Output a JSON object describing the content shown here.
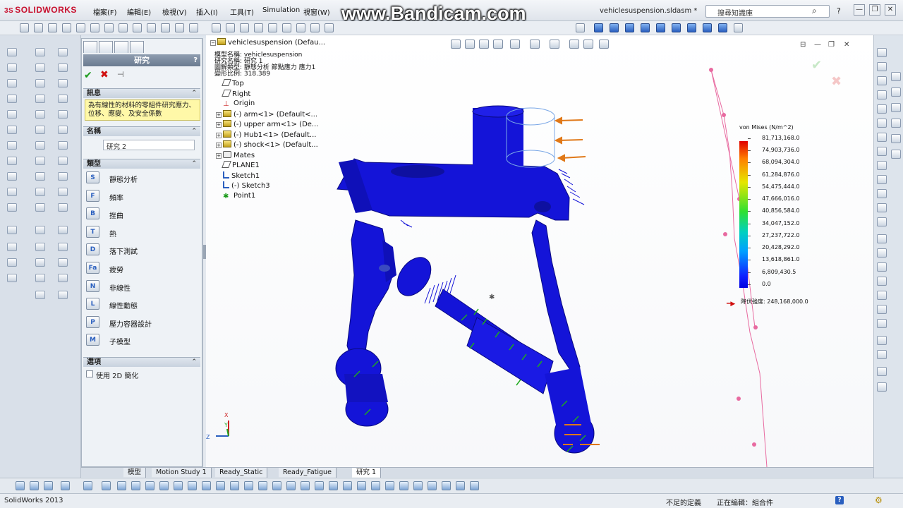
{
  "titlebar": {
    "logo_prefix": "3S",
    "logo": "SOLIDWORKS",
    "menus": [
      "檔案(F)",
      "編輯(E)",
      "檢視(V)",
      "插入(I)",
      "工具(T)",
      "Simulation",
      "視窗(W)"
    ],
    "watermark": "www.Bandicam.com",
    "document_title": "vehiclesuspension.sldasm *",
    "search_placeholder": "搜尋知識庫",
    "help_glyph": "?",
    "minimize_glyph": "—",
    "restore_glyph": "❐",
    "close_glyph": "✕"
  },
  "property_manager": {
    "header": "研究",
    "help": "?",
    "ok_glyph": "✔",
    "cancel_glyph": "✖",
    "pin_glyph": "⊣",
    "info_section": "訊息",
    "info_text": "為有線性的材料的零組件研究應力、位移、應變、及安全係數",
    "name_section": "名稱",
    "name_value": "研究 2",
    "type_section": "類型",
    "types": [
      {
        "label": "靜態分析",
        "icon": "static-analysis-icon",
        "glyph": "S"
      },
      {
        "label": "頻率",
        "icon": "frequency-icon",
        "glyph": "F"
      },
      {
        "label": "挫曲",
        "icon": "buckling-icon",
        "glyph": "B"
      },
      {
        "label": "熱",
        "icon": "thermal-icon",
        "glyph": "T"
      },
      {
        "label": "落下測試",
        "icon": "drop-test-icon",
        "glyph": "D"
      },
      {
        "label": "疲勞",
        "icon": "fatigue-icon",
        "glyph": "Fa"
      },
      {
        "label": "非線性",
        "icon": "nonlinear-icon",
        "glyph": "N"
      },
      {
        "label": "線性動態",
        "icon": "linear-dynamic-icon",
        "glyph": "L"
      },
      {
        "label": "壓力容器設計",
        "icon": "pressure-vessel-icon",
        "glyph": "P"
      },
      {
        "label": "子模型",
        "icon": "submodel-icon",
        "glyph": "M"
      }
    ],
    "options_section": "選項",
    "option_2d": "使用 2D 簡化",
    "chevron": "⌃"
  },
  "tree": {
    "root": "vehiclesuspension  (Defau...",
    "overlay_lines": [
      "模型名稱: vehiclesuspension",
      "研究名稱: 研究 1",
      "圖解類型: 靜態分析 節點應力 應力1",
      "變形比例: 318.389"
    ],
    "items": [
      {
        "label": "Top",
        "icon": "plane",
        "expander": ""
      },
      {
        "label": "Right",
        "icon": "plane",
        "expander": ""
      },
      {
        "label": "Origin",
        "icon": "origin",
        "expander": ""
      },
      {
        "label": "(-) arm<1> (Default<...",
        "icon": "part",
        "expander": "+"
      },
      {
        "label": "(-) upper arm<1> (De...",
        "icon": "part",
        "expander": "+"
      },
      {
        "label": "(-) Hub1<1> (Default...",
        "icon": "part",
        "expander": "+"
      },
      {
        "label": "(-) shock<1> (Default...",
        "icon": "part",
        "expander": "+"
      },
      {
        "label": "Mates",
        "icon": "mates",
        "expander": "+"
      },
      {
        "label": "PLANE1",
        "icon": "plane",
        "expander": ""
      },
      {
        "label": "Sketch1",
        "icon": "sketch",
        "expander": ""
      },
      {
        "label": "(-) Sketch3",
        "icon": "sketch",
        "expander": ""
      },
      {
        "label": "Point1",
        "icon": "point",
        "expander": ""
      }
    ],
    "origin_glyph": "⊥",
    "point_glyph": "✱"
  },
  "legend": {
    "title": "von Mises (N/m^2)",
    "values": [
      "81,713,168.0",
      "74,903,736.0",
      "68,094,304.0",
      "61,284,876.0",
      "54,475,444.0",
      "47,666,016.0",
      "40,856,584.0",
      "34,047,152.0",
      "27,237,722.0",
      "20,428,292.0",
      "13,618,861.0",
      "6,809,430.5",
      "0.0"
    ],
    "yield_label": "降伏強度: 248,168,000.0",
    "yield_arrow": "━▶"
  },
  "triad": {
    "x": "X",
    "y": "Y",
    "z": "Z"
  },
  "bottom_tabs": [
    "模型",
    "Motion Study 1",
    "Ready_Static",
    "Ready_Fatigue",
    "研究 1"
  ],
  "statusbar": {
    "app": "SolidWorks 2013",
    "definition": "不足的定義",
    "editing": "正在編輯：組合件",
    "help": "?",
    "grip": "⚙"
  },
  "colors": {
    "mesh_blue": "#1414d8",
    "load_arrow": "#e07818",
    "fixture_green": "#1faa1f",
    "sketch_pink": "#e86aa0"
  }
}
